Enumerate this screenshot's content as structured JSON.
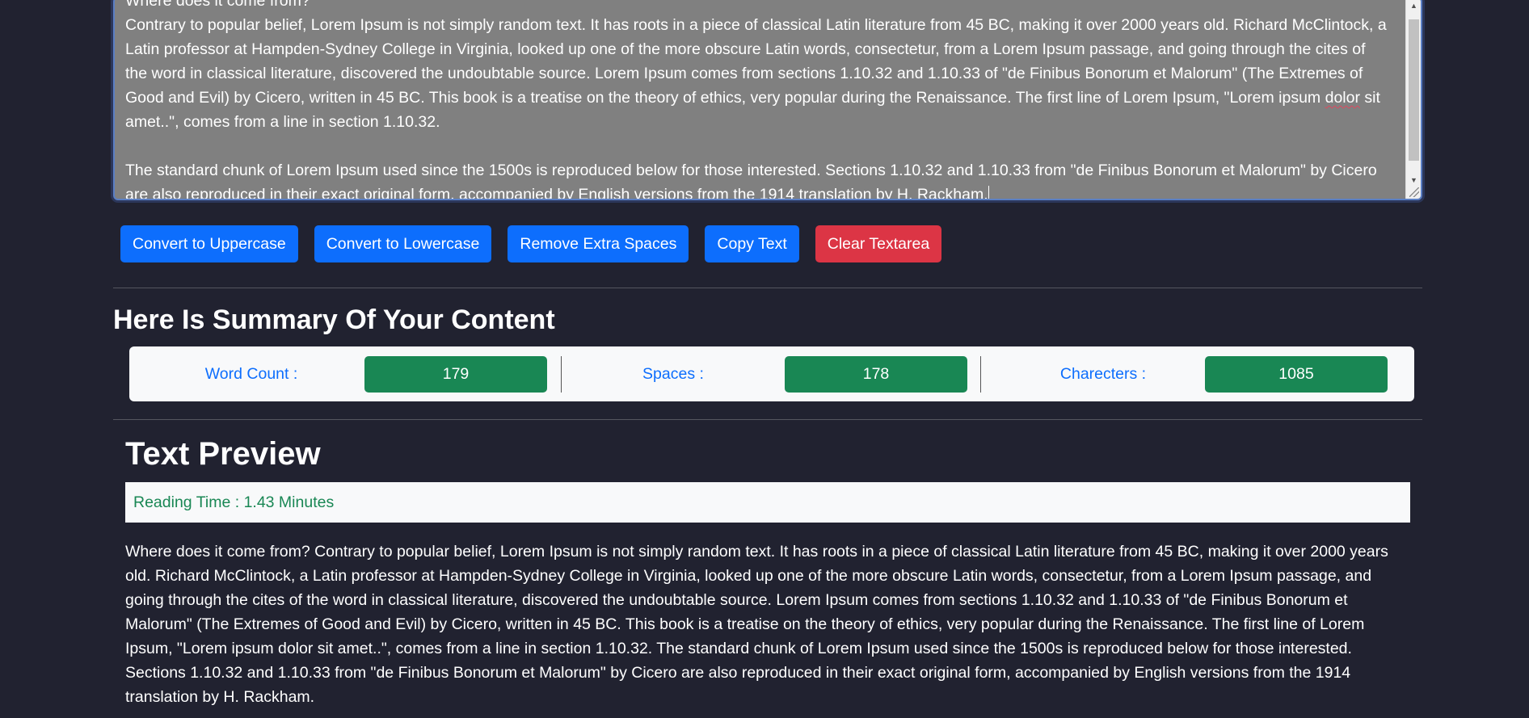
{
  "editor": {
    "line_hidden": "Where does it come from?",
    "para1_a": "Contrary to popular belief, Lorem Ipsum is not simply random text. It has roots in a piece of classical Latin literature from 45 BC, making it over 2000 years old. Richard McClintock, a Latin professor at Hampden-Sydney College in Virginia, looked up one of the more obscure Latin words, consectetur, from a Lorem Ipsum passage, and going through the cites of the word in classical literature, discovered the undoubtable source. Lorem Ipsum comes from sections 1.10.32 and 1.10.33 of \"de Finibus Bonorum et Malorum\" (The Extremes of Good and Evil) by Cicero, written in 45 BC. This book is a treatise on the theory of ethics, very popular during the Renaissance. The first line of Lorem Ipsum, \"Lorem ipsum ",
    "para1_spell": "dolor",
    "para1_b": " sit amet..\", comes from a line in section 1.10.32.",
    "para2": "The standard chunk of Lorem Ipsum used since the 1500s is reproduced below for those interested. Sections 1.10.32 and 1.10.33 from \"de Finibus Bonorum et Malorum\" by Cicero are also reproduced in their exact original form, accompanied by English versions from the 1914 translation by H. Rackham."
  },
  "buttons": {
    "uppercase": "Convert to Uppercase",
    "lowercase": "Convert to Lowercase",
    "remove_spaces": "Remove Extra Spaces",
    "copy": "Copy Text",
    "clear": "Clear Textarea"
  },
  "summary": {
    "title": "Here Is Summary Of Your Content",
    "word_count_label": "Word Count :",
    "word_count": "179",
    "spaces_label": "Spaces :",
    "spaces": "178",
    "characters_label": "Charecters :",
    "characters": "1085"
  },
  "preview": {
    "title": "Text Preview",
    "reading_time": "Reading Time : 1.43 Minutes",
    "text": "Where does it come from? Contrary to popular belief, Lorem Ipsum is not simply random text. It has roots in a piece of classical Latin literature from 45 BC, making it over 2000 years old. Richard McClintock, a Latin professor at Hampden-Sydney College in Virginia, looked up one of the more obscure Latin words, consectetur, from a Lorem Ipsum passage, and going through the cites of the word in classical literature, discovered the undoubtable source. Lorem Ipsum comes from sections 1.10.32 and 1.10.33 of \"de Finibus Bonorum et Malorum\" (The Extremes of Good and Evil) by Cicero, written in 45 BC. This book is a treatise on the theory of ethics, very popular during the Renaissance. The first line of Lorem Ipsum, \"Lorem ipsum dolor sit amet..\", comes from a line in section 1.10.32. The standard chunk of Lorem Ipsum used since the 1500s is reproduced below for those interested. Sections 1.10.32 and 1.10.33 from \"de Finibus Bonorum et Malorum\" by Cicero are also reproduced in their exact original form, accompanied by English versions from the 1914 translation by H. Rackham."
  },
  "colors": {
    "page_bg": "#212230",
    "textarea_bg": "#808080",
    "primary": "#0d6efd",
    "danger": "#dc3545",
    "success": "#198754"
  },
  "icons": {
    "scroll_up": "scroll-up-arrow-icon",
    "scroll_down": "scroll-down-arrow-icon",
    "resize": "resize-grip-icon"
  }
}
